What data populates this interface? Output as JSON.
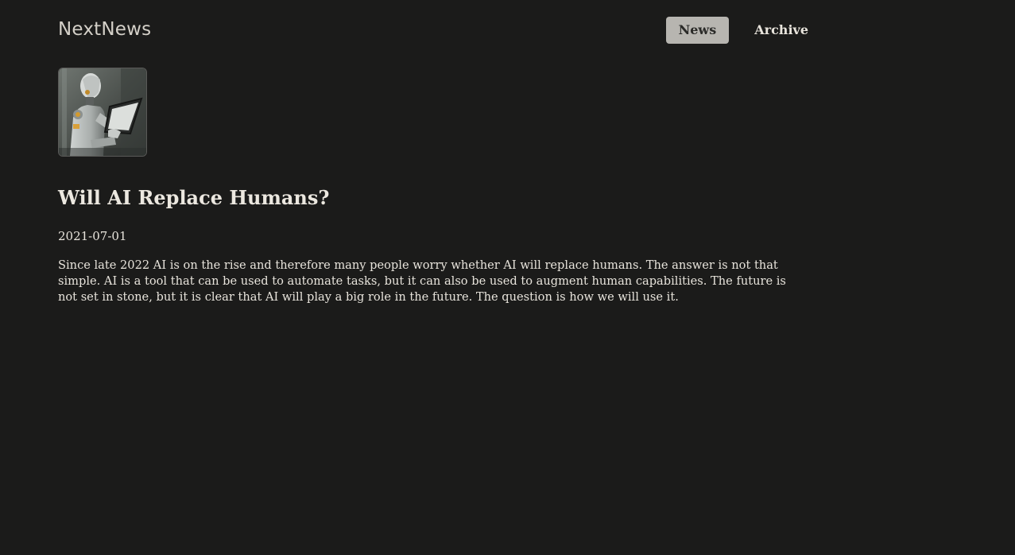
{
  "header": {
    "logo": "NextNews",
    "nav": [
      {
        "label": "News",
        "active": true
      },
      {
        "label": "Archive",
        "active": false
      }
    ]
  },
  "article": {
    "thumbnail_icon": "robot-reading-tablet-image",
    "title": "Will AI Replace Humans?",
    "date": "2021-07-01",
    "body": "Since late 2022 AI is on the rise and therefore many people worry whether AI will replace humans. The answer is not that simple. AI is a tool that can be used to automate tasks, but it can also be used to augment human capabilities. The future is not set in stone, but it is clear that AI will play a big role in the future. The question is how we will use it."
  },
  "colors": {
    "background": "#1b1b1a",
    "text": "#e8e4dc",
    "nav_active_bg": "#b7b5b0"
  }
}
